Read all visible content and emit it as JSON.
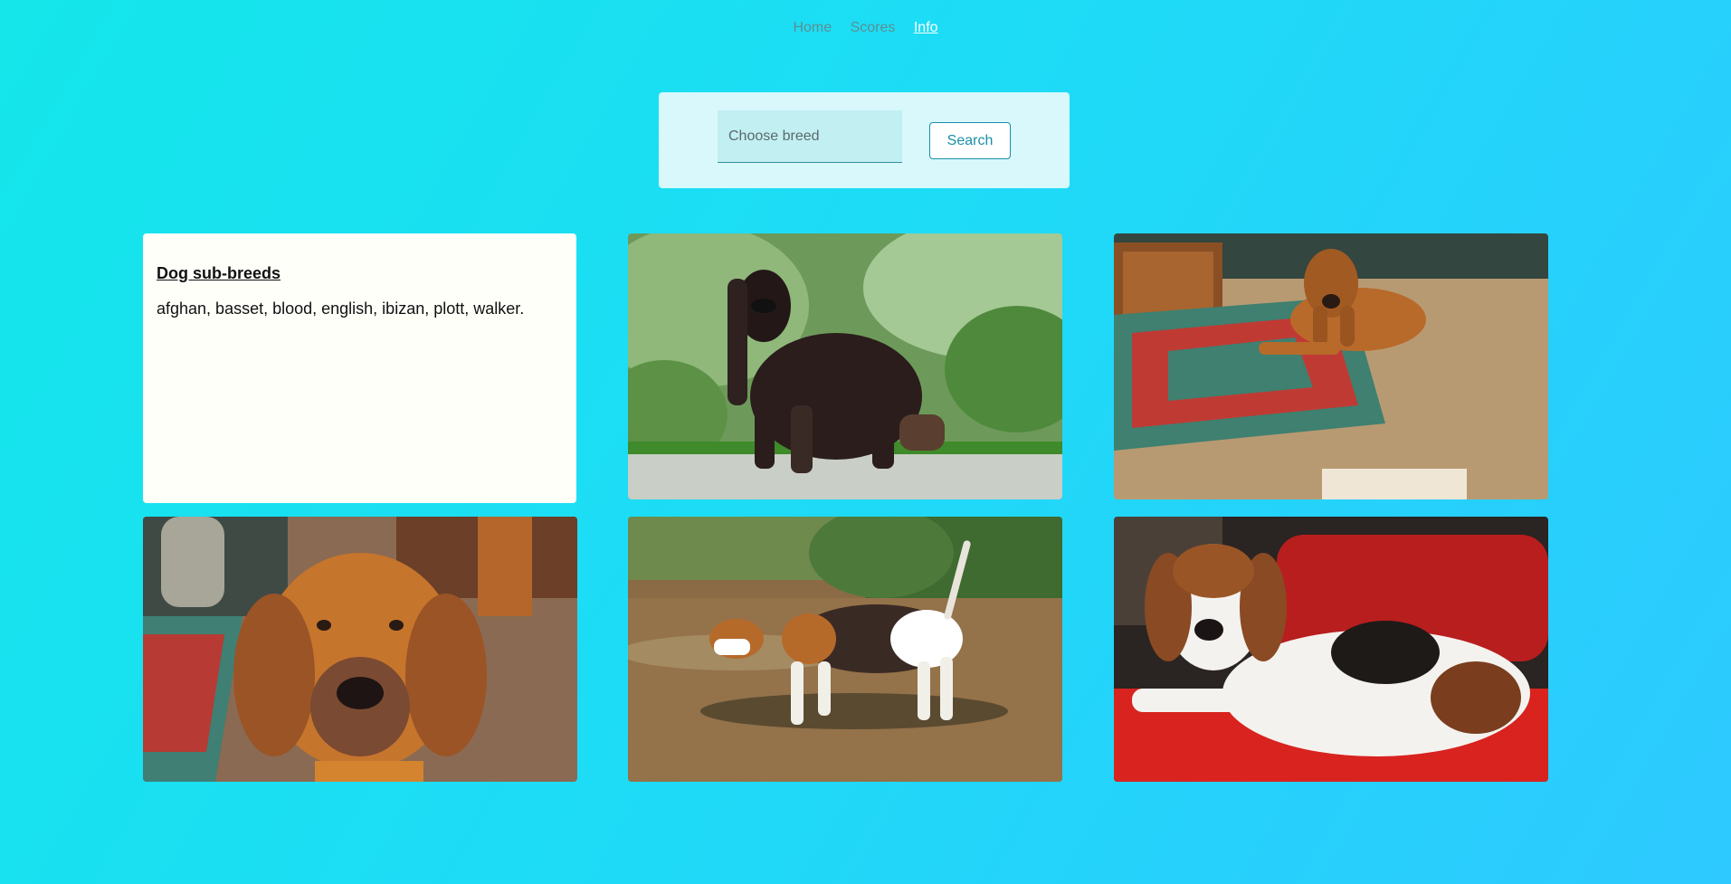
{
  "nav": {
    "items": [
      {
        "label": "Home"
      },
      {
        "label": "Scores"
      },
      {
        "label": "Info"
      }
    ]
  },
  "search": {
    "placeholder": "Choose breed",
    "button_label": "Search"
  },
  "info_card": {
    "title": "Dog sub-breeds",
    "text": "afghan, basset, blood, english, ibizan, plott, walker."
  },
  "photos": [
    {
      "name": "dog-photo-afghan",
      "alt": "afghan"
    },
    {
      "name": "dog-photo-bloodhound-lying",
      "alt": "blood"
    },
    {
      "name": "dog-photo-bloodhound-portrait",
      "alt": "blood"
    },
    {
      "name": "dog-photo-english-hound",
      "alt": "english"
    },
    {
      "name": "dog-photo-walker-hound",
      "alt": "walker"
    }
  ],
  "colors": {
    "accent": "#1a8fa8",
    "nav_active": "#ffffff",
    "nav_inactive": "#5d8e95",
    "panel": "#d8f8fc",
    "card": "#fffffa"
  }
}
